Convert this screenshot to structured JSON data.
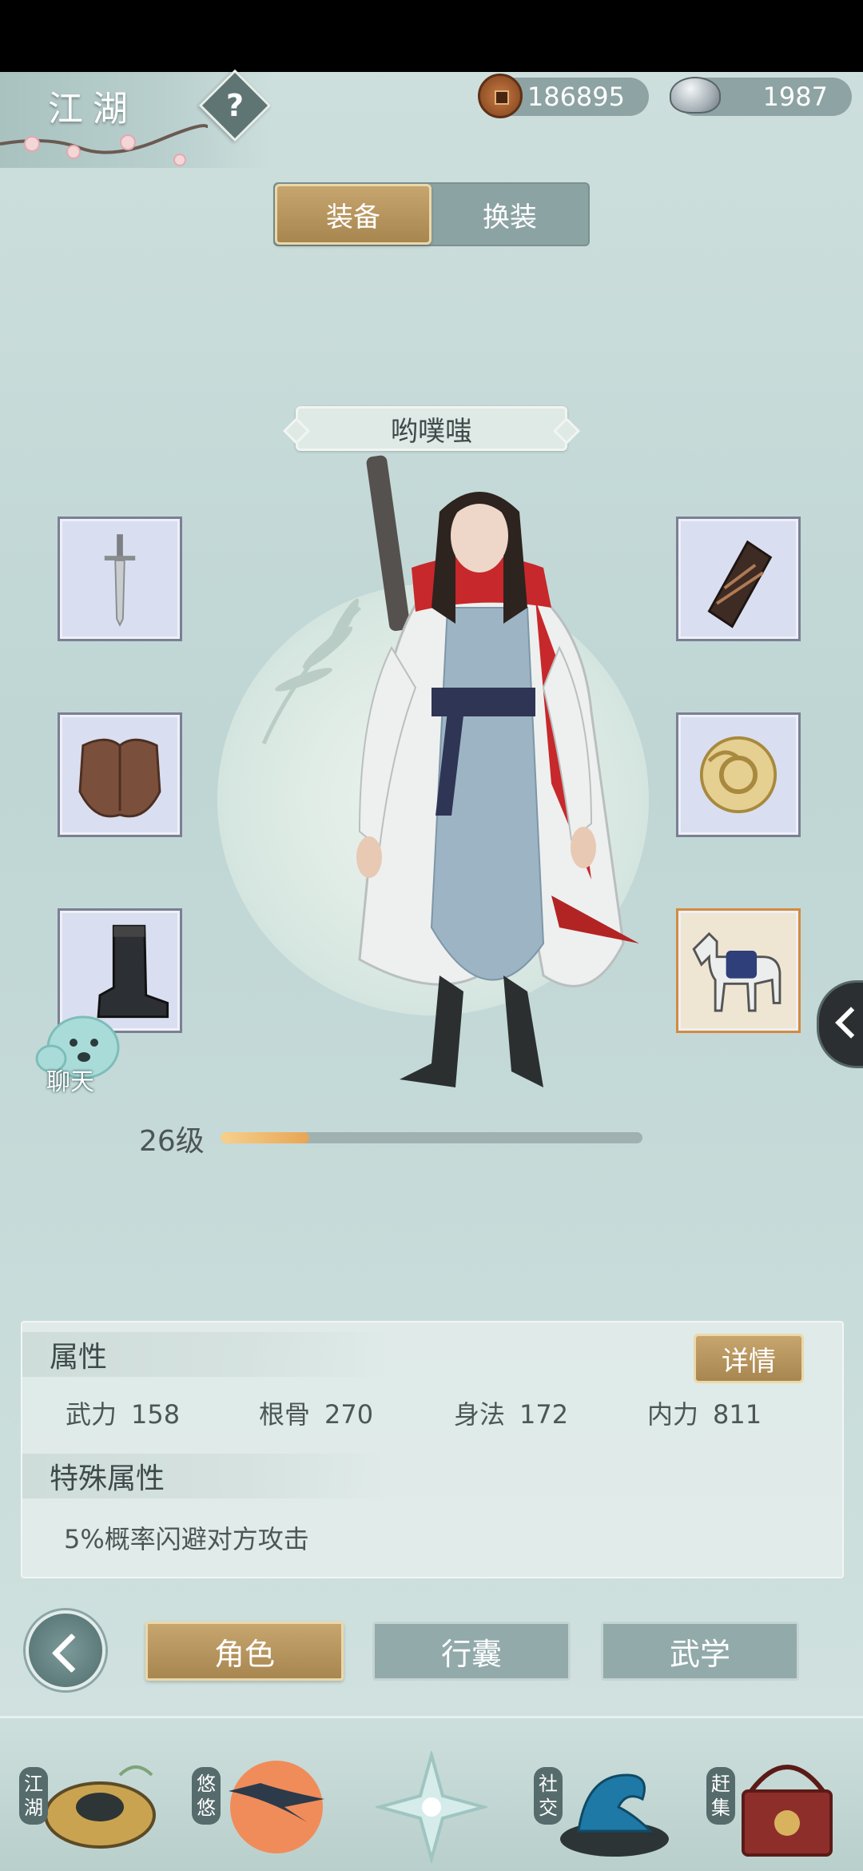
{
  "header": {
    "title": "江湖",
    "help_symbol": "?",
    "currency": [
      {
        "icon": "copper-coin-icon",
        "value": "186895"
      },
      {
        "icon": "silver-ingot-icon",
        "value": "1987"
      }
    ]
  },
  "tabs": {
    "equipment": "装备",
    "outfit": "换装"
  },
  "character": {
    "name": "哟噗嗤",
    "level_text": "26级",
    "level_progress": 0.21
  },
  "chat": {
    "label": "聊天"
  },
  "attributes": {
    "heading": "属性",
    "detail_button": "详情",
    "stats": [
      {
        "label": "武力",
        "value": "158"
      },
      {
        "label": "根骨",
        "value": "270"
      },
      {
        "label": "身法",
        "value": "172"
      },
      {
        "label": "内力",
        "value": "811"
      }
    ],
    "special_heading": "特殊属性",
    "special_text": "5%概率闪避对方攻击"
  },
  "nav": {
    "role": "角色",
    "bag": "行囊",
    "martial": "武学"
  },
  "dock": {
    "jianghu": "江湖",
    "youyou": "悠悠",
    "social": "社交",
    "market": "赶集"
  },
  "colors": {
    "gold_button": "#b8955e",
    "teal_button": "#93aaab",
    "level_fill": "#e8a554"
  }
}
